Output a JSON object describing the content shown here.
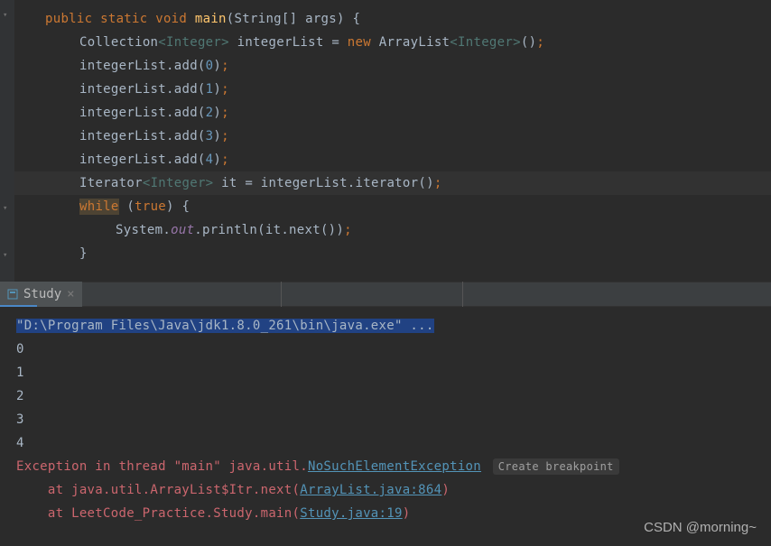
{
  "code": {
    "sig_public": "public",
    "sig_static": "static",
    "sig_void": "void",
    "sig_main": "main",
    "sig_params": "(String[] args) {",
    "line2_type": "Collection",
    "line2_generic": "<Integer>",
    "line2_var": " integerList = ",
    "line2_new": "new",
    "line2_class": " ArrayList",
    "line2_gen2": "<Integer>",
    "line2_end": "()",
    "add0_call": "integerList.add(",
    "add0_num": "0",
    "add0_end": ")",
    "add1_num": "1",
    "add2_num": "2",
    "add3_num": "3",
    "add4_num": "4",
    "iter_type": "Iterator",
    "iter_gen": "<Integer>",
    "iter_rest": " it = integerList.iterator()",
    "while_kw": "while",
    "while_cond_open": " (",
    "while_true": "true",
    "while_cond_close": ") {",
    "sys": "System.",
    "out": "out",
    "println": ".println(it.next())",
    "close_brace": "}",
    "semi": ";"
  },
  "tab": {
    "name": "Study",
    "close": "×"
  },
  "console": {
    "cmd": "\"D:\\Program Files\\Java\\jdk1.8.0_261\\bin\\java.exe\" ...",
    "out0": "0",
    "out1": "1",
    "out2": "2",
    "out3": "3",
    "out4": "4",
    "exc_prefix": "Exception in thread \"main\" java.util.",
    "exc_name": "NoSuchElementException",
    "create_bp": "Create breakpoint",
    "at1_pre": "    at java.util.ArrayList$Itr.next(",
    "at1_link": "ArrayList.java:864",
    "at1_post": ")",
    "at2_pre": "    at LeetCode_Practice.Study.main(",
    "at2_link": "Study.java:19",
    "at2_post": ")"
  },
  "watermark": "CSDN @morning~"
}
